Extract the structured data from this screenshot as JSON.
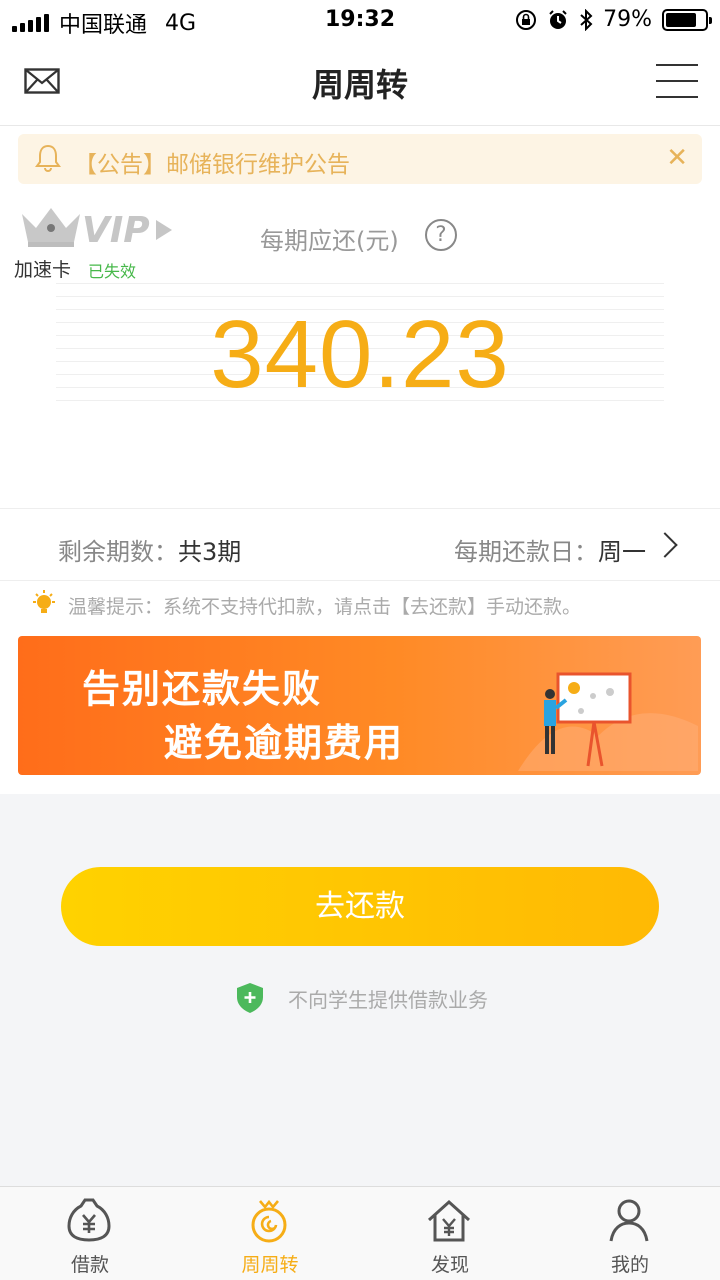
{
  "status_bar": {
    "carrier": "中国联通",
    "network": "4G",
    "time": "19:32",
    "battery": "79%",
    "battery_level": 0.79
  },
  "nav": {
    "title": "周周转",
    "icons": {
      "left": "mail-icon",
      "right": "menu-icon"
    }
  },
  "notice": {
    "text": "【公告】邮储银行维护公告",
    "icons": {
      "bell": "bell-icon",
      "close": "close-icon"
    }
  },
  "vip": {
    "badge_text": "VIP",
    "card_label": "加速卡",
    "status": "已失效"
  },
  "repayment": {
    "label": "每期应还(元)",
    "amount": "340.23",
    "remaining_label": "剩余期数：",
    "remaining_value": "共3期",
    "payday_label": "每期还款日：",
    "payday_value": "周一"
  },
  "tip": {
    "text": "温馨提示：系统不支持代扣款，请点击【去还款】手动还款。"
  },
  "banner": {
    "line1": "告别还款失败",
    "line2": "避免逾期费用"
  },
  "actions": {
    "repay_label": "去还款",
    "student_note": "不向学生提供借款业务"
  },
  "tabs": [
    {
      "label": "借款",
      "icon": "money-bag-icon",
      "active": false
    },
    {
      "label": "周周转",
      "icon": "cycle-icon",
      "active": true
    },
    {
      "label": "发现",
      "icon": "house-yen-icon",
      "active": false
    },
    {
      "label": "我的",
      "icon": "person-icon",
      "active": false
    }
  ],
  "colors": {
    "accent": "#f6ad16",
    "notice_bg": "#fdf4e4",
    "notice_text": "#e7b35a",
    "valid_green": "#47b84a",
    "banner_orange": "#ff6d1a"
  }
}
